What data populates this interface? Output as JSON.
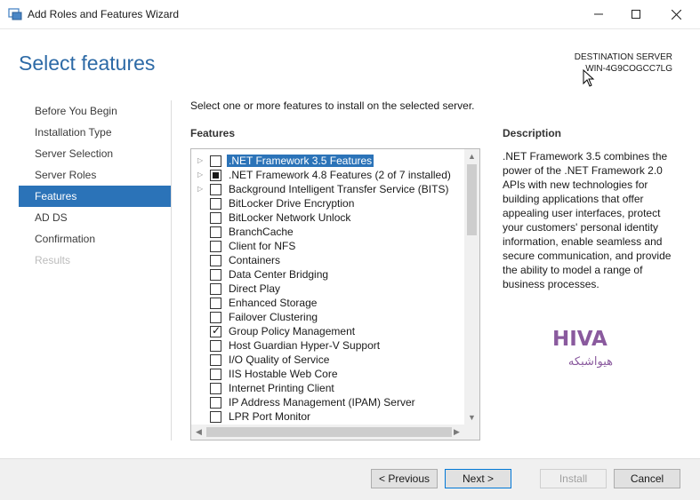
{
  "window": {
    "title": "Add Roles and Features Wizard",
    "minimize_glyph": "—",
    "maximize_glyph": "☐",
    "close_glyph": "✕"
  },
  "page": {
    "title": "Select features",
    "destination_label": "DESTINATION SERVER",
    "destination_server": "WIN-4G9COGCC7LG"
  },
  "nav": {
    "items": [
      {
        "label": "Before You Begin",
        "state": "normal"
      },
      {
        "label": "Installation Type",
        "state": "normal"
      },
      {
        "label": "Server Selection",
        "state": "normal"
      },
      {
        "label": "Server Roles",
        "state": "normal"
      },
      {
        "label": "Features",
        "state": "active"
      },
      {
        "label": "AD DS",
        "state": "normal"
      },
      {
        "label": "Confirmation",
        "state": "normal"
      },
      {
        "label": "Results",
        "state": "disabled"
      }
    ]
  },
  "main": {
    "instruction": "Select one or more features to install on the selected server.",
    "features_heading": "Features",
    "features": [
      {
        "label": ".NET Framework 3.5 Features",
        "expandable": true,
        "check": "unchecked",
        "selected": true
      },
      {
        "label": ".NET Framework 4.8 Features (2 of 7 installed)",
        "expandable": true,
        "check": "partial",
        "selected": false
      },
      {
        "label": "Background Intelligent Transfer Service (BITS)",
        "expandable": true,
        "check": "unchecked",
        "selected": false
      },
      {
        "label": "BitLocker Drive Encryption",
        "expandable": false,
        "check": "unchecked",
        "selected": false
      },
      {
        "label": "BitLocker Network Unlock",
        "expandable": false,
        "check": "unchecked",
        "selected": false
      },
      {
        "label": "BranchCache",
        "expandable": false,
        "check": "unchecked",
        "selected": false
      },
      {
        "label": "Client for NFS",
        "expandable": false,
        "check": "unchecked",
        "selected": false
      },
      {
        "label": "Containers",
        "expandable": false,
        "check": "unchecked",
        "selected": false
      },
      {
        "label": "Data Center Bridging",
        "expandable": false,
        "check": "unchecked",
        "selected": false
      },
      {
        "label": "Direct Play",
        "expandable": false,
        "check": "unchecked",
        "selected": false
      },
      {
        "label": "Enhanced Storage",
        "expandable": false,
        "check": "unchecked",
        "selected": false
      },
      {
        "label": "Failover Clustering",
        "expandable": false,
        "check": "unchecked",
        "selected": false
      },
      {
        "label": "Group Policy Management",
        "expandable": false,
        "check": "checked",
        "selected": false
      },
      {
        "label": "Host Guardian Hyper-V Support",
        "expandable": false,
        "check": "unchecked",
        "selected": false
      },
      {
        "label": "I/O Quality of Service",
        "expandable": false,
        "check": "unchecked",
        "selected": false
      },
      {
        "label": "IIS Hostable Web Core",
        "expandable": false,
        "check": "unchecked",
        "selected": false
      },
      {
        "label": "Internet Printing Client",
        "expandable": false,
        "check": "unchecked",
        "selected": false
      },
      {
        "label": "IP Address Management (IPAM) Server",
        "expandable": false,
        "check": "unchecked",
        "selected": false
      },
      {
        "label": "LPR Port Monitor",
        "expandable": false,
        "check": "unchecked",
        "selected": false
      }
    ],
    "description_heading": "Description",
    "description_text": ".NET Framework 3.5 combines the power of the .NET Framework 2.0 APIs with new technologies for building applications that offer appealing user interfaces, protect your customers' personal identity information, enable seamless and secure communication, and provide the ability to model a range of business processes."
  },
  "logo": {
    "latin": "HIVA",
    "persian": "هیواشبکه",
    "color": "#8a5a9e"
  },
  "footer": {
    "previous_label": "< Previous",
    "next_label": "Next >",
    "install_label": "Install",
    "cancel_label": "Cancel"
  },
  "colors": {
    "accent": "#2b73b8",
    "title": "#2d6aa6"
  }
}
